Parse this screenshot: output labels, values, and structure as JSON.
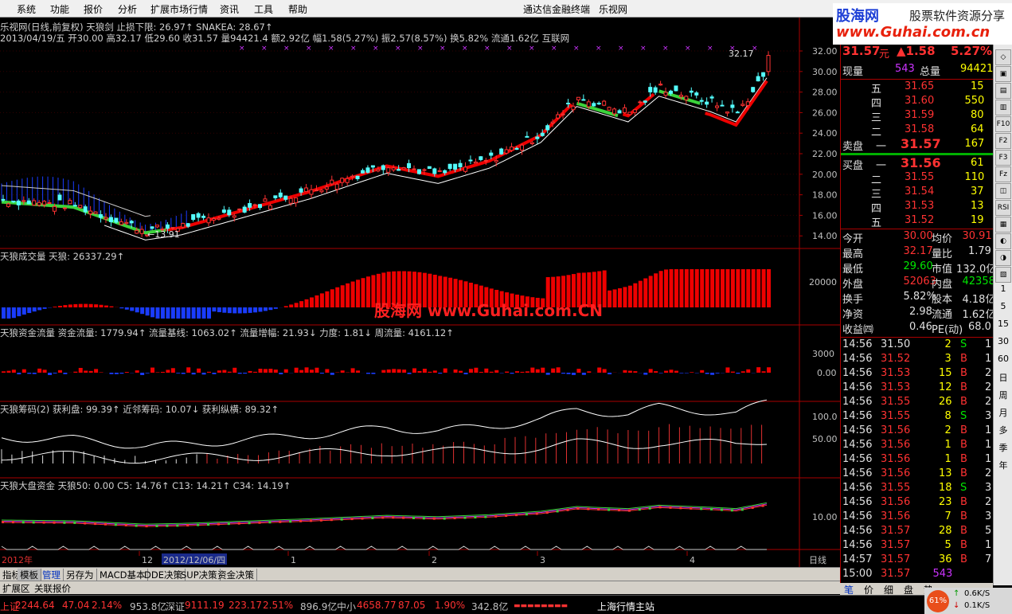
{
  "menu": {
    "items": [
      "系统",
      "功能",
      "报价",
      "分析",
      "扩展市场行情",
      "资讯",
      "工具",
      "帮助"
    ],
    "title": "通达信金融终端",
    "stock": "乐视网"
  },
  "watermark": {
    "line1": "股海网",
    "line1b": "股票软件资源分享",
    "line2": "www.Guhai.com.cn",
    "center": "股海网 www.Guhai.com.CN"
  },
  "main": {
    "title": "乐视网(日线,前复权) 天狼剑 止损下限: 26.97↑ SNAKEA: 28.67↑",
    "info": "2013/04/19/五 开30.00 高32.17 低29.60 收31.57 量94421.4 额2.92亿 幅1.58(5.27%) 振2.57(8.57%) 换5.82% 流通1.62亿 互联网",
    "high_label": "32.17",
    "low_label": "13.91",
    "yticks": [
      "32.00",
      "30.00",
      "28.00",
      "26.00",
      "24.00",
      "22.00",
      "20.00",
      "18.00",
      "16.00",
      "14.00"
    ]
  },
  "panels": [
    {
      "title": "天狼成交量 天狼: 26337.29↑",
      "ticks": [
        "20000"
      ]
    },
    {
      "title": "天狼资金流量  资金流量: 1779.94↑  流量基线: 1063.02↑  流量增幅: 21.93↓  力度: 1.81↓  周流量: 4161.12↑",
      "ticks": [
        "3000",
        "0.00"
      ]
    },
    {
      "title": "天狼筹码(2)  获利盘: 99.39↑  近邻筹码: 10.07↓  获利纵横: 89.32↑",
      "ticks": [
        "100.0",
        "50.00"
      ]
    },
    {
      "title": "天狼大盘资金  天狼50: 0.00  C5: 14.76↑  C13: 14.21↑  C34: 14.19↑",
      "ticks": [
        "10.00"
      ]
    }
  ],
  "xaxis": {
    "labels": [
      "2012年",
      "12",
      "2012/12/06/四",
      "1",
      "2",
      "3",
      "4"
    ],
    "right": "日线"
  },
  "quote": {
    "price": "31.57",
    "unit": "元",
    "change": "▲1.58",
    "pct": "5.27%",
    "xianliang_label": "现量",
    "xianliang": "543",
    "zongliang_label": "总量",
    "zongliang": "94421",
    "asks": [
      [
        "五",
        "31.65",
        "15"
      ],
      [
        "四",
        "31.60",
        "550"
      ],
      [
        "三",
        "31.59",
        "80"
      ],
      [
        "二",
        "31.58",
        "64"
      ],
      [
        "一",
        "31.57",
        "167"
      ]
    ],
    "ask_label": "卖盘",
    "bid_label": "买盘",
    "bids": [
      [
        "一",
        "31.56",
        "61"
      ],
      [
        "二",
        "31.55",
        "110"
      ],
      [
        "三",
        "31.54",
        "37"
      ],
      [
        "四",
        "31.53",
        "13"
      ],
      [
        "五",
        "31.52",
        "19"
      ]
    ],
    "stats": [
      [
        "今开",
        "30.00",
        "均价",
        "30.91"
      ],
      [
        "最高",
        "32.17",
        "量比",
        "1.79"
      ],
      [
        "最低",
        "29.60",
        "市值",
        "132.0亿"
      ],
      [
        "外盘",
        "52063",
        "内盘",
        "42358"
      ],
      [
        "换手",
        "5.82%",
        "股本",
        "4.18亿"
      ],
      [
        "净资",
        "2.98",
        "流通",
        "1.62亿"
      ],
      [
        "收益㈣",
        "0.46",
        "PE(动)",
        "68.0"
      ]
    ],
    "ticks": [
      [
        "14:56",
        "31.50",
        "2",
        "S",
        "1"
      ],
      [
        "14:56",
        "31.52",
        "3",
        "B",
        "1"
      ],
      [
        "14:56",
        "31.53",
        "15",
        "B",
        "2"
      ],
      [
        "14:56",
        "31.53",
        "12",
        "B",
        "2"
      ],
      [
        "14:56",
        "31.55",
        "26",
        "B",
        "2"
      ],
      [
        "14:56",
        "31.55",
        "8",
        "S",
        "3"
      ],
      [
        "14:56",
        "31.56",
        "2",
        "B",
        "1"
      ],
      [
        "14:56",
        "31.56",
        "1",
        "B",
        "1"
      ],
      [
        "14:56",
        "31.56",
        "1",
        "B",
        "1"
      ],
      [
        "14:56",
        "31.56",
        "13",
        "B",
        "2"
      ],
      [
        "14:56",
        "31.55",
        "18",
        "S",
        "3"
      ],
      [
        "14:56",
        "31.56",
        "23",
        "B",
        "2"
      ],
      [
        "14:56",
        "31.56",
        "7",
        "B",
        "3"
      ],
      [
        "14:56",
        "31.57",
        "28",
        "B",
        "5"
      ],
      [
        "14:56",
        "31.57",
        "5",
        "B",
        "1"
      ],
      [
        "14:57",
        "31.57",
        "36",
        "B",
        "7"
      ],
      [
        "15:00",
        "31.57",
        "543",
        "",
        ""
      ]
    ]
  },
  "toolbar": {
    "btns": [
      "◇",
      "▣",
      "▤",
      "▥",
      "F10",
      "F2",
      "F3",
      "Fz",
      "◫",
      "RSI",
      "▦",
      "◐",
      "◑",
      "▧"
    ],
    "nums": [
      "1",
      "5",
      "15",
      "30",
      "60",
      "日",
      "周",
      "月",
      "多",
      "季",
      "年"
    ]
  },
  "bottomtabs": [
    "指标",
    "模板",
    "管理",
    "另存为",
    "MACD基本",
    "DDE决策",
    "SUP决策",
    "资金决策"
  ],
  "tabs2": [
    "扩展区",
    "关联报价"
  ],
  "righttabs": [
    "笔",
    "价",
    "细",
    "盘",
    "势"
  ],
  "status": {
    "sh_label": "上证",
    "sh": "2244.64",
    "sh_chg": "47.04",
    "sh_pct": "2.14%",
    "sh_amt": "953.8亿",
    "sz_label": "深证",
    "sz": "9111.19",
    "sz_chg": "223.17",
    "sz_pct": "2.51%",
    "sz_amt": "896.9亿",
    "zx_label": "中小",
    "zx": "4658.77",
    "zx_chg": "87.05",
    "zx_pct": "1.90%",
    "zx_amt": "342.8亿",
    "site": "上海行情主站"
  },
  "net": {
    "pct": "61%",
    "up": "0.6K/S",
    "down": "0.1K/S"
  },
  "colors": {
    "up": "#ff3232",
    "down": "#00e600",
    "bg": "#000000",
    "frame": "#a00000"
  }
}
